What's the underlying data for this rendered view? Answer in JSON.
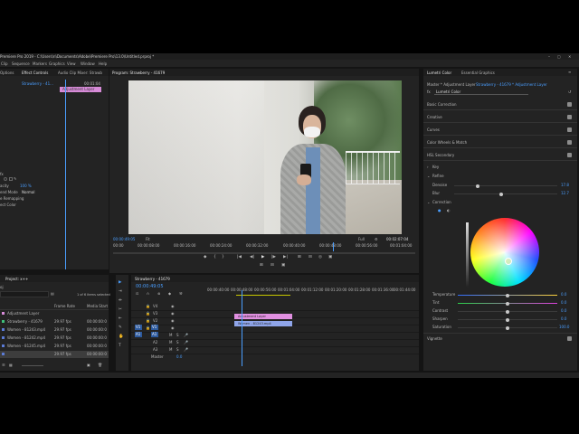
{
  "app": {
    "title": "Premiere Pro 2019 - C:\\Users\\n\\Documents\\Adobe\\Premiere Pro\\13.0\\Untitled.prproj *",
    "win_controls": [
      "–",
      "▢",
      "✕"
    ]
  },
  "menu": [
    "Clip",
    "Sequence",
    "Markers",
    "Graphics",
    "View",
    "Window",
    "Help"
  ],
  "effect_controls": {
    "left_tab": "Options",
    "tab": "Effect Controls",
    "tab2": "Audio Clip Mixer: Strawb",
    "source": "Strawberry - 41...",
    "clip_time": "00:01:04",
    "clip_label": "Adjustment Layer",
    "props": [
      "fx",
      "acity",
      "end Mode",
      "e Remapping",
      "ect Color"
    ],
    "opacity_val": "100 %",
    "blend_val": "Normal",
    "start_time": "00:00"
  },
  "program": {
    "tab": "Program: Strawberry - 41679",
    "timecode": "00:00:49:05",
    "fit": "Fit",
    "quality": "Full",
    "duration": "00:02:07:04",
    "ruler": [
      "00:00",
      "00:00:08:00",
      "00:00:16:00",
      "00:00:24:00",
      "00:00:32:00",
      "00:00:40:00",
      "00:00:48:00",
      "00:00:56:00",
      "00:01:04:00"
    ],
    "transport": [
      "◆",
      "{",
      "}",
      "|◀",
      "◀|",
      "▶",
      "|▶",
      "▶|",
      "⊞",
      "⊟",
      "◎",
      "▣",
      "⊕"
    ],
    "transport2": [
      "⊞",
      "⊟",
      "▣"
    ]
  },
  "project": {
    "tab": "Project: x++",
    "search_label": "oj",
    "items_selected": "1 of 6 items selected",
    "col_frame_rate": "Frame Rate",
    "col_media_start": "Media Start",
    "rows": [
      {
        "name": "Adjustment Layer",
        "fps": "",
        "start": ""
      },
      {
        "name": "Strawberry - 41679",
        "fps": "29.97 fps",
        "start": "00:00:00:0"
      },
      {
        "name": "Women - 81243.mp4",
        "fps": "29.97 fps",
        "start": "00:00:00:0"
      },
      {
        "name": "Women - 81242.mp4",
        "fps": "29.97 fps",
        "start": "00:00:00:0"
      },
      {
        "name": "Women - 81245.mp4",
        "fps": "29.97 fps",
        "start": "00:00:00:0"
      },
      {
        "name": "",
        "fps": "29.97 fps",
        "start": "00:00:00:0"
      }
    ]
  },
  "timeline": {
    "tab": "Strawberry - 41679",
    "timecode": "00:00:49:05",
    "ruler": [
      "00:00:40:00",
      "00:00:48:00",
      "00:00:56:00",
      "00:01:04:00",
      "00:01:12:00",
      "00:01:20:00",
      "00:01:28:00",
      "00:01:36:00",
      "00:01:44:00"
    ],
    "tracks": [
      "V4",
      "V3",
      "V2",
      "V1",
      "A1",
      "A2",
      "A3"
    ],
    "src_labels": [
      "V1",
      "A1"
    ],
    "master_label": "Master",
    "master_val": "0.0",
    "clip_adjustment": "Adjustment Layer",
    "clip_women": "Women - 81243.mp4"
  },
  "lumetri": {
    "tab": "Lumetri Color",
    "tab2": "Essential Graphics",
    "source": "Master * Adjustment Layer",
    "target": "Strawberry - 41679 * Adjustment Layer",
    "fx_label": "Lumetri Color",
    "sections": [
      "Basic Correction",
      "Creative",
      "Curves",
      "Color Wheels & Match",
      "HSL Secondary"
    ],
    "key_label": "Key",
    "refine_label": "Refine",
    "denoise_label": "Denoise",
    "denoise_val": "17.8",
    "blur_val": "12.7",
    "correction_label": "Correction",
    "sliders": [
      {
        "label": "Temperature",
        "val": "0.0"
      },
      {
        "label": "Tint",
        "val": "0.0"
      },
      {
        "label": "Contrast",
        "val": "0.0"
      },
      {
        "label": "Sharpen",
        "val": "0.0"
      },
      {
        "label": "Saturation",
        "val": "100.0"
      }
    ],
    "vignette_label": "Vignette"
  },
  "tools": [
    "▶",
    "⇥",
    "⇹",
    "✂",
    "⇤",
    "✎",
    "✋",
    "T"
  ]
}
